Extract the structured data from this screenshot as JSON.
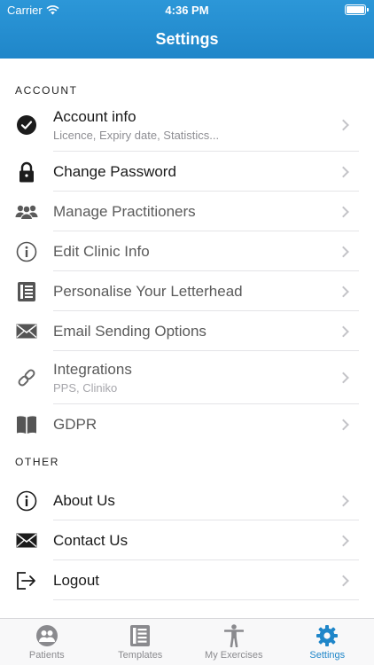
{
  "status": {
    "carrier": "Carrier",
    "time": "4:36 PM"
  },
  "nav": {
    "title": "Settings"
  },
  "account": {
    "header": "ACCOUNT",
    "items": [
      {
        "title": "Account info",
        "subtitle": "Licence, Expiry date, Statistics...",
        "icon": "checkmark-circle-icon"
      },
      {
        "title": "Change Password",
        "icon": "lock-icon"
      },
      {
        "title": "Manage Practitioners",
        "icon": "people-icon"
      },
      {
        "title": "Edit Clinic Info",
        "icon": "info-circle-icon"
      },
      {
        "title": "Personalise Your Letterhead",
        "icon": "document-icon"
      },
      {
        "title": "Email Sending Options",
        "icon": "envelope-icon"
      },
      {
        "title": "Integrations",
        "subtitle": "PPS, Cliniko",
        "icon": "link-icon"
      },
      {
        "title": "GDPR",
        "icon": "book-icon"
      }
    ]
  },
  "other": {
    "header": "OTHER",
    "items": [
      {
        "title": "About Us",
        "icon": "info-circle-icon"
      },
      {
        "title": "Contact Us",
        "icon": "envelope-icon"
      },
      {
        "title": "Logout",
        "icon": "logout-icon"
      }
    ]
  },
  "tabs": [
    {
      "label": "Patients",
      "icon": "patients-icon"
    },
    {
      "label": "Templates",
      "icon": "templates-icon"
    },
    {
      "label": "My Exercises",
      "icon": "exercise-figure-icon"
    },
    {
      "label": "Settings",
      "icon": "gear-icon",
      "active": true
    }
  ],
  "colors": {
    "accent": "#1f86c9",
    "navbar": "#2a93d5"
  }
}
